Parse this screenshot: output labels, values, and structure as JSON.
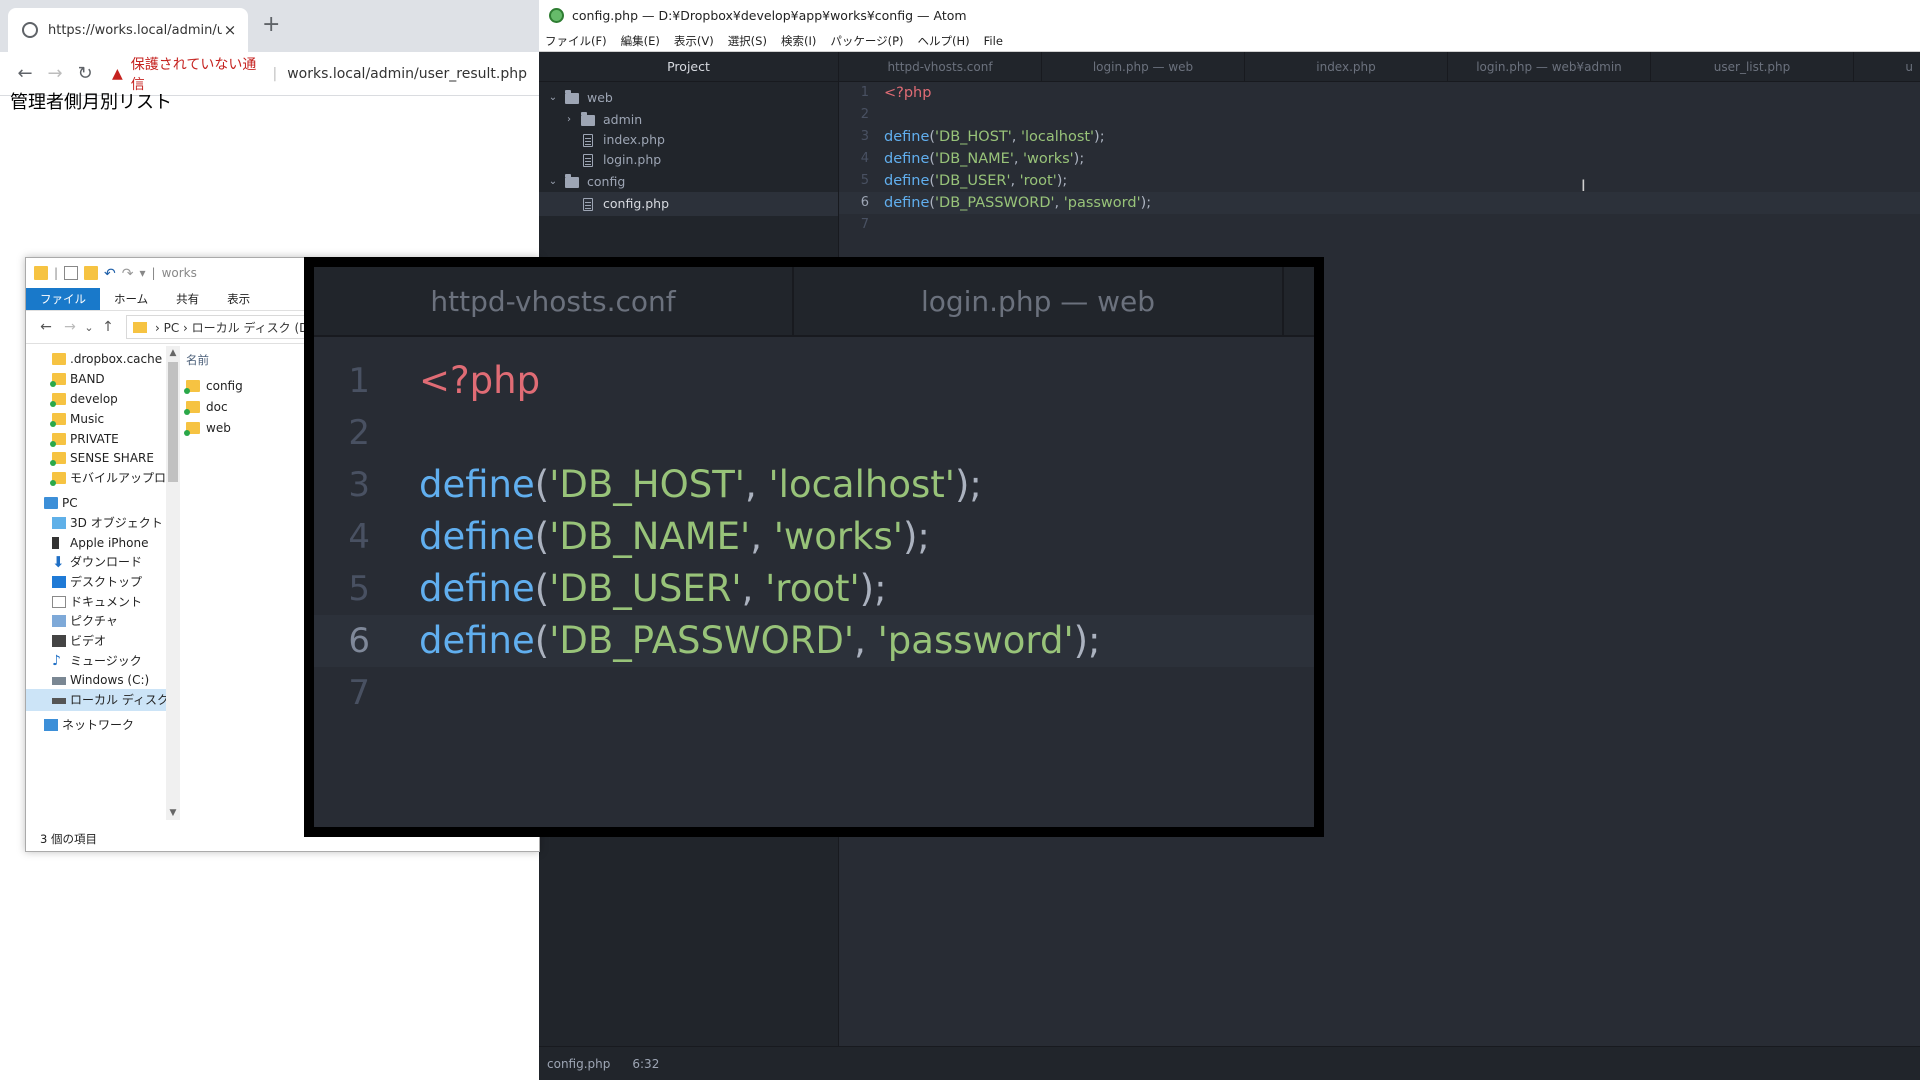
{
  "browser": {
    "tab_title": "https://works.local/admin/user_r",
    "tab_close": "×",
    "new_tab": "+",
    "back": "←",
    "forward": "→",
    "reload": "↻",
    "warning_icon": "▲",
    "insecure_label": "保護されていない通信",
    "separator": "|",
    "url": "works.local/admin/user_result.php",
    "page_heading": "管理者側月別リスト"
  },
  "atom": {
    "window_title": "config.php — D:¥Dropbox¥develop¥app¥works¥config — Atom",
    "menu": [
      "ファイル(F)",
      "編集(E)",
      "表示(V)",
      "選択(S)",
      "検索(I)",
      "パッケージ(P)",
      "ヘルプ(H)",
      "File"
    ],
    "tree": {
      "header": "Project",
      "items": [
        {
          "label": "web",
          "type": "folder",
          "expanded": true,
          "depth": 0
        },
        {
          "label": "admin",
          "type": "folder",
          "expanded": false,
          "depth": 1
        },
        {
          "label": "index.php",
          "type": "file",
          "depth": 1
        },
        {
          "label": "login.php",
          "type": "file",
          "depth": 1
        },
        {
          "label": "config",
          "type": "folder",
          "expanded": true,
          "depth": 0
        },
        {
          "label": "config.php",
          "type": "file",
          "depth": 1,
          "selected": true
        }
      ]
    },
    "tabs": [
      "httpd-vhosts.conf",
      "login.php — web",
      "index.php",
      "login.php — web¥admin",
      "user_list.php",
      "u"
    ],
    "code": {
      "lines": [
        {
          "num": "1",
          "tokens": [
            {
              "t": "<?php",
              "c": "tag"
            }
          ]
        },
        {
          "num": "2",
          "tokens": []
        },
        {
          "num": "3",
          "tokens": [
            {
              "t": "define",
              "c": "fn"
            },
            {
              "t": "(",
              "c": "punc"
            },
            {
              "t": "'DB_HOST'",
              "c": "str"
            },
            {
              "t": ", ",
              "c": "punc"
            },
            {
              "t": "'localhost'",
              "c": "str"
            },
            {
              "t": ");",
              "c": "punc"
            }
          ]
        },
        {
          "num": "4",
          "tokens": [
            {
              "t": "define",
              "c": "fn"
            },
            {
              "t": "(",
              "c": "punc"
            },
            {
              "t": "'DB_NAME'",
              "c": "str"
            },
            {
              "t": ", ",
              "c": "punc"
            },
            {
              "t": "'works'",
              "c": "str"
            },
            {
              "t": ");",
              "c": "punc"
            }
          ]
        },
        {
          "num": "5",
          "tokens": [
            {
              "t": "define",
              "c": "fn"
            },
            {
              "t": "(",
              "c": "punc"
            },
            {
              "t": "'DB_USER'",
              "c": "str"
            },
            {
              "t": ", ",
              "c": "punc"
            },
            {
              "t": "'root'",
              "c": "str"
            },
            {
              "t": ");",
              "c": "punc"
            }
          ]
        },
        {
          "num": "6",
          "tokens": [
            {
              "t": "define",
              "c": "fn"
            },
            {
              "t": "(",
              "c": "punc"
            },
            {
              "t": "'DB_PASSWORD'",
              "c": "str"
            },
            {
              "t": ", ",
              "c": "punc"
            },
            {
              "t": "'password'",
              "c": "str"
            },
            {
              "t": ");",
              "c": "punc"
            }
          ],
          "current": true
        },
        {
          "num": "7",
          "tokens": []
        }
      ]
    },
    "status": {
      "file": "config.php",
      "cursor": "6:32"
    },
    "colors": {
      "tag": "#e06c75",
      "fn": "#61afef",
      "punc": "#abb2bf",
      "str": "#98c379"
    }
  },
  "explorer": {
    "title": "works",
    "qat_sep": "|",
    "undo": "↶",
    "redo": "↷",
    "qat_more": "▾",
    "ribbon_tabs": [
      "ファイル",
      "ホーム",
      "共有",
      "表示"
    ],
    "nav_back": "←",
    "nav_forward": "→",
    "nav_recent": "⌄",
    "nav_up": "↑",
    "address": "›  PC  ›  ローカル ディスク (D:)",
    "nav_items": [
      {
        "label": ".dropbox.cache",
        "icon": "folder"
      },
      {
        "label": "BAND",
        "icon": "folder-sync"
      },
      {
        "label": "develop",
        "icon": "folder-sync"
      },
      {
        "label": "Music",
        "icon": "folder-sync"
      },
      {
        "label": "PRIVATE",
        "icon": "folder-sync"
      },
      {
        "label": "SENSE SHARE",
        "icon": "folder-sync"
      },
      {
        "label": "モバイルアップロード",
        "icon": "folder-sync"
      },
      {
        "label": "PC",
        "icon": "pc"
      },
      {
        "label": "3D オブジェクト",
        "icon": "3d"
      },
      {
        "label": "Apple iPhone",
        "icon": "phone"
      },
      {
        "label": "ダウンロード",
        "icon": "down"
      },
      {
        "label": "デスクトップ",
        "icon": "desk"
      },
      {
        "label": "ドキュメント",
        "icon": "doc"
      },
      {
        "label": "ピクチャ",
        "icon": "pic"
      },
      {
        "label": "ビデオ",
        "icon": "vid"
      },
      {
        "label": "ミュージック",
        "icon": "music"
      },
      {
        "label": "Windows (C:)",
        "icon": "drive"
      },
      {
        "label": "ローカル ディスク (D:)",
        "icon": "drive2",
        "selected": true
      },
      {
        "label": "ネットワーク",
        "icon": "net"
      }
    ],
    "scroll_up": "▲",
    "scroll_down": "▼",
    "column_header": "名前",
    "files": [
      "config",
      "doc",
      "web"
    ],
    "status_count": "3 個の項目"
  },
  "zoom": {
    "tabs": [
      "httpd-vhosts.conf",
      "login.php — web"
    ]
  }
}
